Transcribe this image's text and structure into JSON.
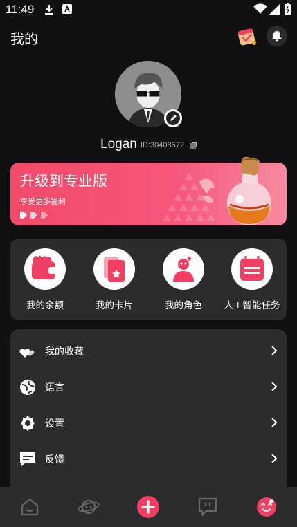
{
  "status_bar": {
    "time": "11:49"
  },
  "header": {
    "title": "我的"
  },
  "profile": {
    "username": "Logan",
    "user_id": "ID:30408572"
  },
  "promo": {
    "title": "升级到专业版",
    "subtitle": "享受更多福利"
  },
  "quick_grid": [
    {
      "label": "我的余额",
      "icon": "wallet-icon"
    },
    {
      "label": "我的卡片",
      "icon": "cards-icon"
    },
    {
      "label": "我的角色",
      "icon": "character-icon"
    },
    {
      "label": "人工智能任务",
      "icon": "calendar-task-icon"
    }
  ],
  "menu": [
    {
      "label": "我的收藏",
      "icon": "favorites-hearts-icon"
    },
    {
      "label": "语言",
      "icon": "globe-icon"
    },
    {
      "label": "设置",
      "icon": "gear-icon"
    },
    {
      "label": "反馈",
      "icon": "feedback-message-icon"
    }
  ],
  "bottom_nav": [
    {
      "icon": "home-icon",
      "active": false
    },
    {
      "icon": "planet-icon",
      "active": false
    },
    {
      "icon": "add-icon",
      "active": true
    },
    {
      "icon": "chat-icon",
      "active": false
    },
    {
      "icon": "profile-face-icon",
      "active": true
    }
  ],
  "colors": {
    "accent": "#ef3f63",
    "background": "#111113",
    "card": "#2c2c2e"
  }
}
